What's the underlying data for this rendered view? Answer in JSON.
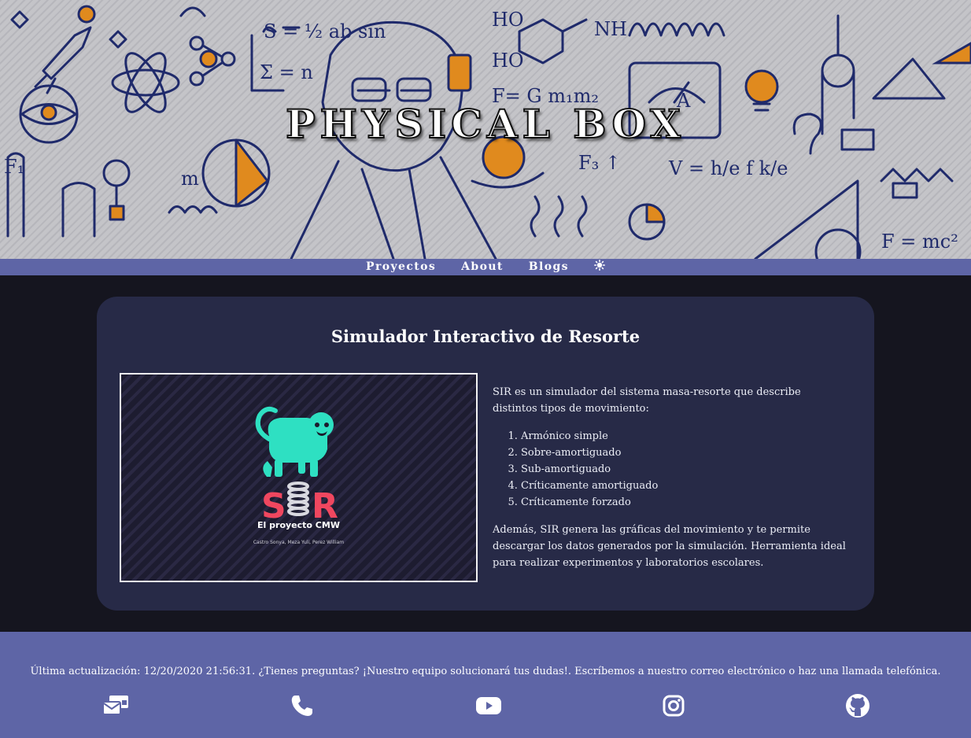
{
  "header": {
    "title": "PHYSICAL BOX",
    "background": "physics-doodles-illustration"
  },
  "nav": {
    "items": [
      {
        "label": "Proyectos"
      },
      {
        "label": "About"
      },
      {
        "label": "Blogs"
      }
    ],
    "theme_toggle_icon": "sun-icon"
  },
  "project": {
    "title": "Simulador Interactivo de Resorte",
    "image": {
      "logo_letters": "SIR",
      "caption": "El proyecto CMW",
      "authors": "Castro Sonya, Meza Yuli, Perez William"
    },
    "intro": "SIR es un simulador del sistema masa-resorte que describe distintos tipos de movimiento:",
    "movements": [
      "Armónico simple",
      "Sobre-amortiguado",
      "Sub-amortiguado",
      "Críticamente amortiguado",
      "Críticamente forzado"
    ],
    "outro": "Además, SIR genera las gráficas del movimiento y te permite descargar los datos generados por la simulación. Herramienta ideal para realizar experimentos y laboratorios escolares."
  },
  "footer": {
    "text": "Última actualización: 12/20/2020 21:56:31. ¿Tienes preguntas? ¡Nuestro equipo solucionará tus dudas!. Escríbemos a nuestro correo electrónico o haz una llamada telefónica.",
    "icons": [
      "mail-icon",
      "phone-icon",
      "youtube-icon",
      "instagram-icon",
      "github-icon"
    ]
  },
  "colors": {
    "nav_bg": "#5e65a6",
    "page_bg": "#15151f",
    "card_bg": "#272a47",
    "logo_teal": "#2ee0c2",
    "logo_red": "#f0475f",
    "doodle_orange": "#e08a1e",
    "doodle_ink": "#1f2a6b"
  }
}
